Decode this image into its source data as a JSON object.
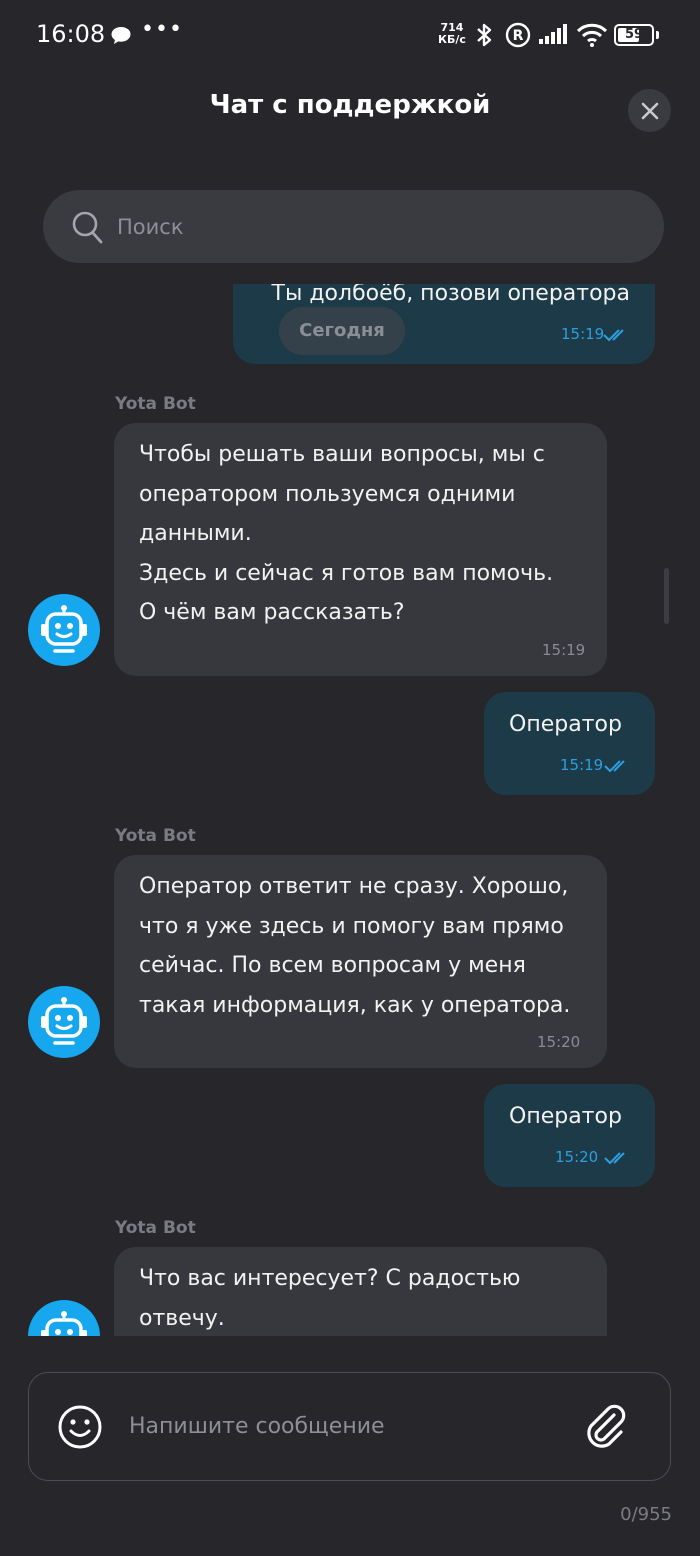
{
  "status_bar": {
    "time": "16:08",
    "speed_value": "714",
    "speed_unit": "КБ/с",
    "battery": "59",
    "icons": [
      "chat-bubble-icon",
      "more-dots-icon",
      "bluetooth-icon",
      "registered-icon",
      "signal-icon",
      "wifi-icon",
      "battery-icon"
    ]
  },
  "header": {
    "title": "Чат с поддержкой",
    "close_icon": "close-icon"
  },
  "search": {
    "placeholder": "Поиск"
  },
  "chat": {
    "date_separator": "Сегодня",
    "messages": [
      {
        "from": "user",
        "text": "Ты долбоёб, позови оператора",
        "time": "15:19",
        "status": "read"
      },
      {
        "from": "bot",
        "sender": "Yota Bot",
        "text": "Чтобы решать ваши вопросы, мы с\nоператором пользуемся одними\nданными.\nЗдесь и сейчас я готов вам помочь.\nО чём вам рассказать?",
        "time": "15:19"
      },
      {
        "from": "user",
        "text": "Оператор",
        "time": "15:19",
        "status": "read"
      },
      {
        "from": "bot",
        "sender": "Yota Bot",
        "text": "Оператор ответит не сразу. Хорошо,\nчто я уже здесь и помогу вам прямо\nсейчас. По всем вопросам у меня\nтакая информация, как у оператора.",
        "time": "15:20"
      },
      {
        "from": "user",
        "text": "Оператор",
        "time": "15:20",
        "status": "read"
      },
      {
        "from": "bot",
        "sender": "Yota Bot",
        "text": "Что вас интересует? С радостью\nотвечу.",
        "time": ""
      }
    ]
  },
  "composer": {
    "placeholder": "Напишите сообщение",
    "counter": "0/955",
    "emoji_icon": "smiley-icon",
    "attach_icon": "paperclip-icon"
  },
  "colors": {
    "background": "#26262b",
    "user_bubble": "#1c3a47",
    "bot_bubble": "#37383e",
    "accent": "#2c9fe0",
    "avatar": "#16a7ef"
  }
}
